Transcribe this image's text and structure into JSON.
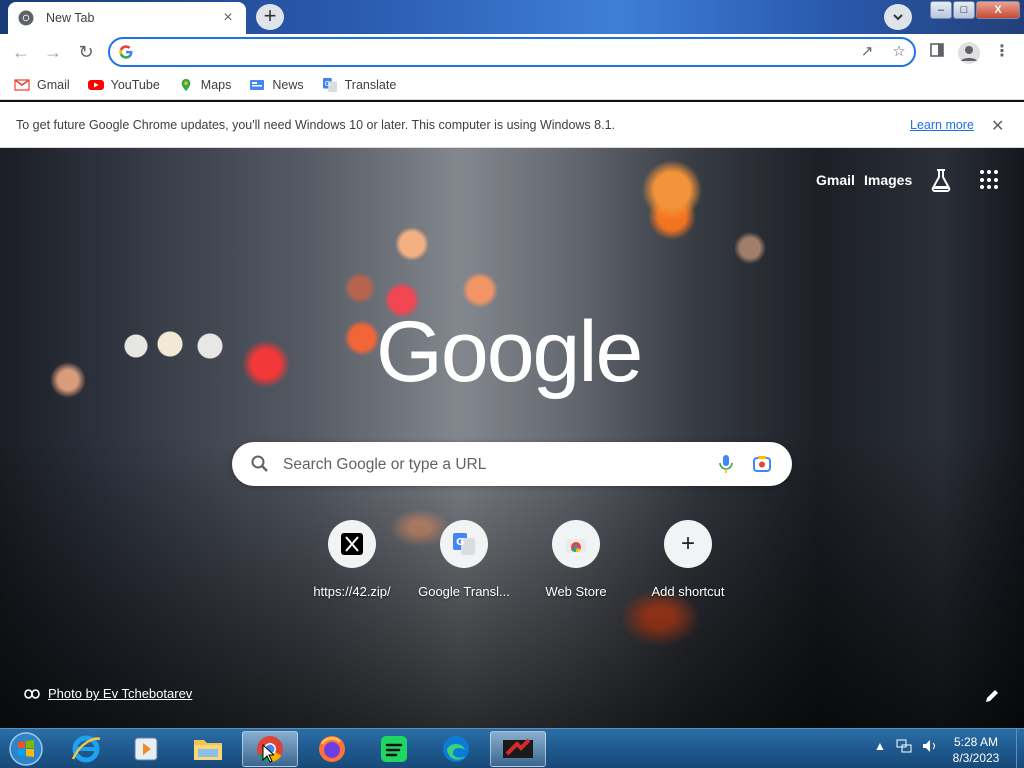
{
  "browser": {
    "tab": {
      "title": "New Tab",
      "close_icon": "×"
    },
    "new_tab_icon": "+",
    "window_buttons": {
      "minimize": "–",
      "maximize": "□",
      "close": "X"
    },
    "omnibox": {
      "value": "",
      "placeholder": ""
    },
    "bookmarks": [
      {
        "label": "Gmail",
        "icon": "gmail-icon",
        "color": "#ea4335"
      },
      {
        "label": "YouTube",
        "icon": "youtube-icon",
        "color": "#ff0000"
      },
      {
        "label": "Maps",
        "icon": "maps-icon",
        "color": "#34a853"
      },
      {
        "label": "News",
        "icon": "news-icon",
        "color": "#4285f4"
      },
      {
        "label": "Translate",
        "icon": "translate-icon",
        "color": "#4285f4"
      }
    ],
    "infobar": {
      "message": "To get future Google Chrome updates, you'll need Windows 10 or later. This computer is using Windows 8.1.",
      "link": "Learn more"
    }
  },
  "ntp": {
    "top_links": {
      "gmail": "Gmail",
      "images": "Images"
    },
    "logo": "Google",
    "search": {
      "placeholder": "Search Google or type a URL"
    },
    "shortcuts": [
      {
        "label": "https://42.zip/",
        "icon": "x-logo-icon"
      },
      {
        "label": "Google Transl...",
        "icon": "google-translate-icon"
      },
      {
        "label": "Web Store",
        "icon": "web-store-icon"
      },
      {
        "label": "Add shortcut",
        "icon": "plus-icon"
      }
    ],
    "photo_credit": "Photo by Ev Tchebotarev"
  },
  "taskbar": {
    "apps": [
      "ie-icon",
      "media-player-icon",
      "file-explorer-icon",
      "chrome-icon",
      "firefox-icon",
      "spotify-icon",
      "edge-icon",
      "game-icon"
    ],
    "active_app": "chrome-icon",
    "clock": {
      "time": "5:28 AM",
      "date": "8/3/2023"
    }
  },
  "colors": {
    "accent": "#1a73e8",
    "taskbar": "#1f5a8f"
  }
}
